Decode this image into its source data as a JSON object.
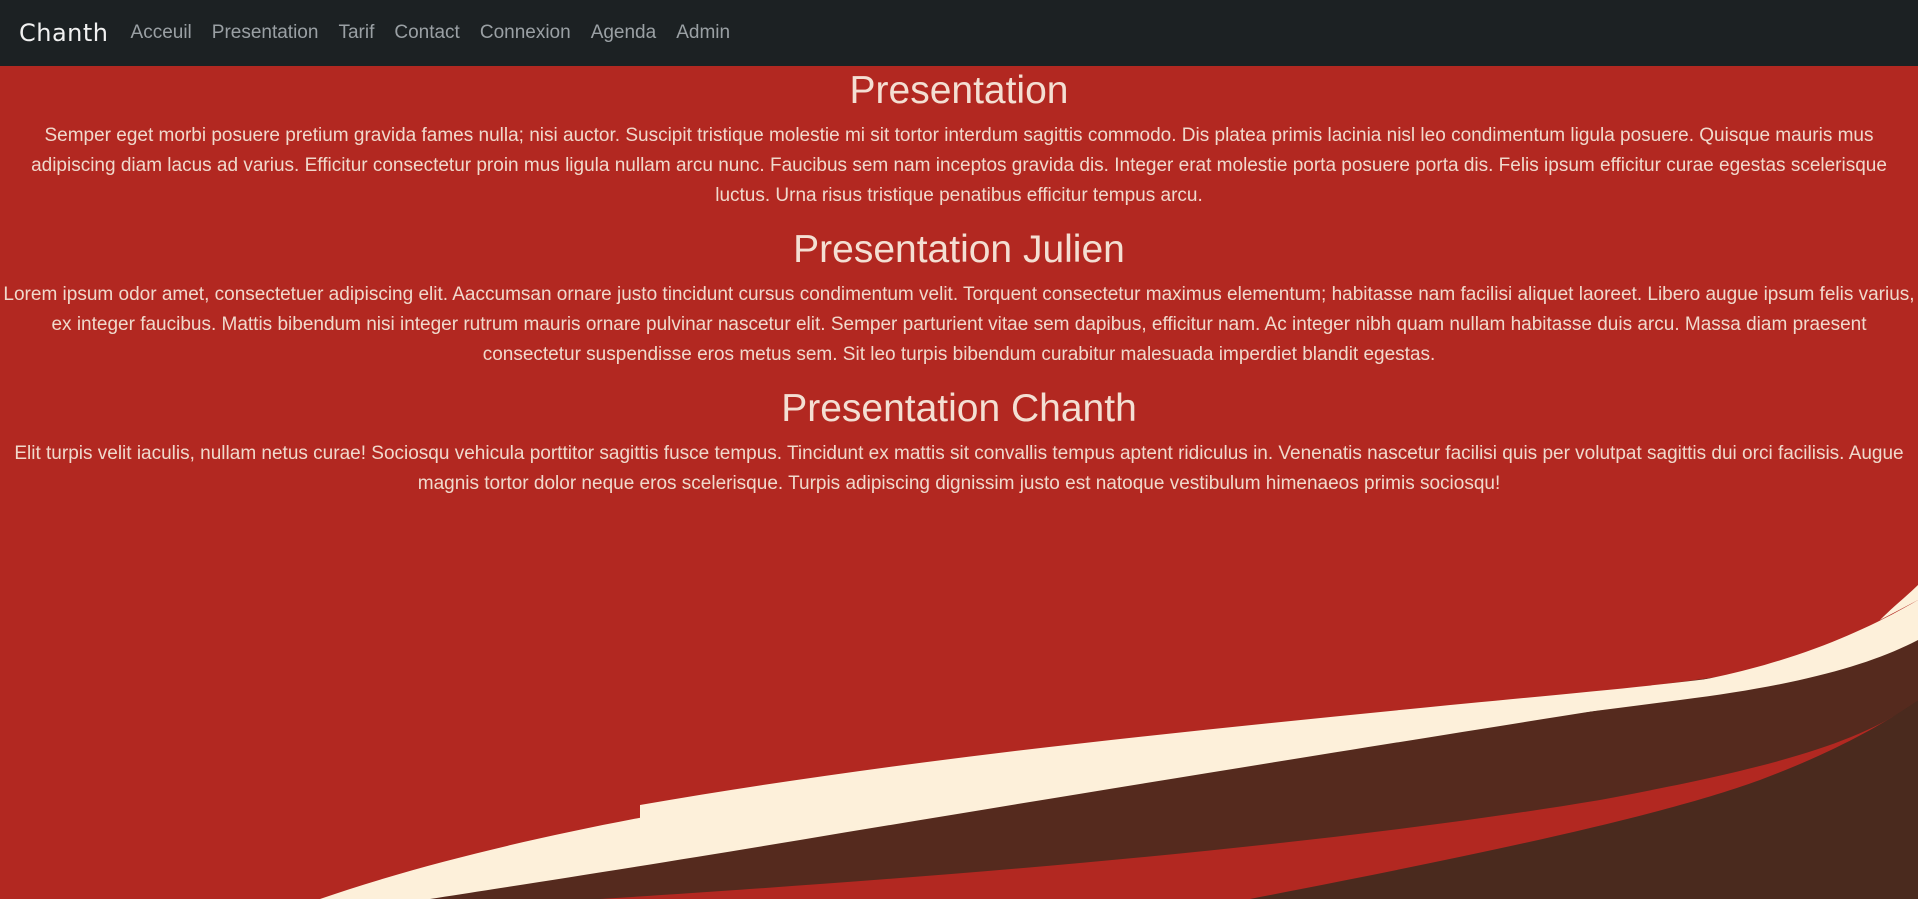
{
  "navbar": {
    "brand": "Chanth",
    "links": [
      "Acceuil",
      "Presentation",
      "Tarif",
      "Contact",
      "Connexion",
      "Agenda",
      "Admin"
    ]
  },
  "sections": [
    {
      "title": "Presentation",
      "text": "Semper eget morbi posuere pretium gravida fames nulla; nisi auctor. Suscipit tristique molestie mi sit tortor interdum sagittis commodo. Dis platea primis lacinia nisl leo condimentum ligula posuere. Quisque mauris mus adipiscing diam lacus ad varius. Efficitur consectetur proin mus ligula nullam arcu nunc. Faucibus sem nam inceptos gravida dis. Integer erat molestie porta posuere porta dis. Felis ipsum efficitur curae egestas scelerisque luctus. Urna risus tristique penatibus efficitur tempus arcu."
    },
    {
      "title": "Presentation Julien",
      "text": "Lorem ipsum odor amet, consectetuer adipiscing elit. Aaccumsan ornare justo tincidunt cursus condimentum velit. Torquent consectetur maximus elementum; habitasse nam facilisi aliquet laoreet. Libero augue ipsum felis varius, ex integer faucibus. Mattis bibendum nisi integer rutrum mauris ornare pulvinar nascetur elit. Semper parturient vitae sem dapibus, efficitur nam. Ac integer nibh quam nullam habitasse duis arcu. Massa diam praesent consectetur suspendisse eros metus sem. Sit leo turpis bibendum curabitur malesuada imperdiet blandit egestas."
    },
    {
      "title": "Presentation Chanth",
      "text": "Elit turpis velit iaculis, nullam netus curae! Sociosqu vehicula porttitor sagittis fusce tempus. Tincidunt ex mattis sit convallis tempus aptent ridiculus in. Venenatis nascetur facilisi quis per volutpat sagittis dui orci facilisis. Augue magnis tortor dolor neque eros scelerisque. Turpis adipiscing dignissim justo est natoque vestibulum himenaeos primis sociosqu!"
    }
  ],
  "colors": {
    "background": "#b22821",
    "navbar": "#1c2123",
    "cream_stripe": "#fdf0da",
    "dark_stripe": "#4a2a1e"
  }
}
